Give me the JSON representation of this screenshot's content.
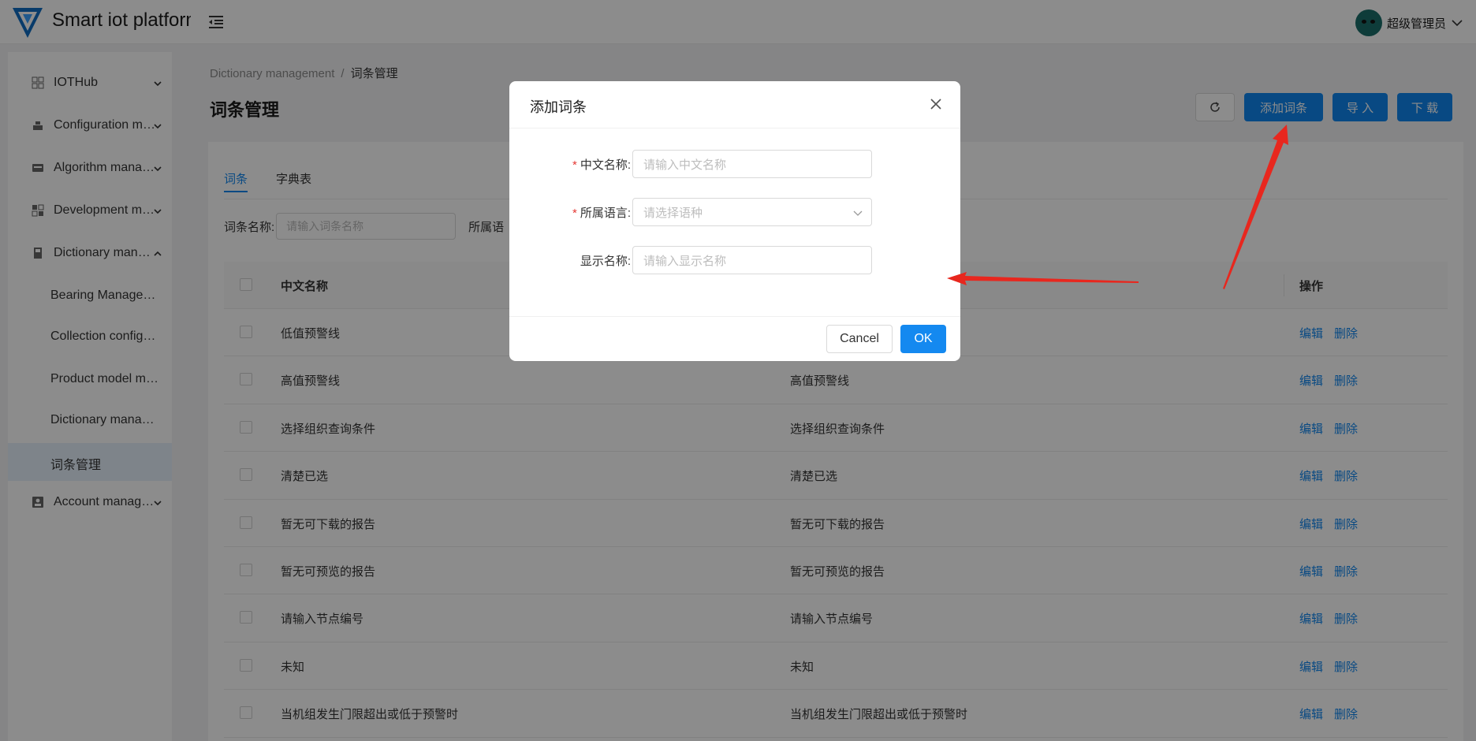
{
  "header": {
    "app_title": "Smart iot platform",
    "user_name": "超级管理员"
  },
  "sidebar": {
    "items": [
      {
        "label": "IOTHub",
        "icon": "grid-icon",
        "expanded": false
      },
      {
        "label": "Configuration management",
        "icon": "config-icon",
        "expanded": false
      },
      {
        "label": "Algorithm management",
        "icon": "algorithm-icon",
        "expanded": false
      },
      {
        "label": "Development management",
        "icon": "development-icon",
        "expanded": false
      },
      {
        "label": "Dictionary management",
        "icon": "dictionary-icon",
        "expanded": true
      }
    ],
    "sub_items": [
      {
        "label": "Bearing Management"
      },
      {
        "label": "Collection configuration"
      },
      {
        "label": "Product model management"
      },
      {
        "label": "Dictionary management"
      },
      {
        "label": "词条管理",
        "active": true
      }
    ],
    "footer_items": [
      {
        "label": "Account management",
        "icon": "account-icon",
        "expanded": false
      }
    ]
  },
  "breadcrumb": {
    "parent": "Dictionary management",
    "separator": "/",
    "current": "词条管理"
  },
  "page": {
    "title": "词条管理",
    "buttons": {
      "add": "添加词条",
      "import": "导 入",
      "download": "下 载"
    }
  },
  "tabs": [
    {
      "label": "词条",
      "active": true
    },
    {
      "label": "字典表",
      "active": false
    }
  ],
  "filter": {
    "name_label": "词条名称:",
    "name_placeholder": "请输入词条名称",
    "lang_label": "所属语"
  },
  "table": {
    "headers": {
      "col1": "中文名称",
      "col3": "操作"
    },
    "actions": {
      "edit": "编辑",
      "delete": "删除"
    },
    "rows": [
      {
        "name": "低值预警线",
        "display": ""
      },
      {
        "name": "高值预警线",
        "display": "高值预警线"
      },
      {
        "name": "选择组织查询条件",
        "display": "选择组织查询条件"
      },
      {
        "name": "清楚已选",
        "display": "清楚已选"
      },
      {
        "name": "暂无可下载的报告",
        "display": "暂无可下载的报告"
      },
      {
        "name": "暂无可预览的报告",
        "display": "暂无可预览的报告"
      },
      {
        "name": "请输入节点编号",
        "display": "请输入节点编号"
      },
      {
        "name": "未知",
        "display": "未知"
      },
      {
        "name": "当机组发生门限超出或低于预警时",
        "display": "当机组发生门限超出或低于预警时"
      }
    ]
  },
  "modal": {
    "title": "添加词条",
    "fields": [
      {
        "label": "中文名称",
        "required": true,
        "placeholder": "请输入中文名称",
        "type": "input"
      },
      {
        "label": "所属语言",
        "required": true,
        "placeholder": "请选择语种",
        "type": "select"
      },
      {
        "label": "显示名称",
        "required": false,
        "placeholder": "请输入显示名称",
        "type": "input"
      }
    ],
    "cancel_label": "Cancel",
    "ok_label": "OK"
  },
  "colors": {
    "primary": "#0f86ee",
    "required": "#e53935",
    "annotation": "#e8271e"
  }
}
